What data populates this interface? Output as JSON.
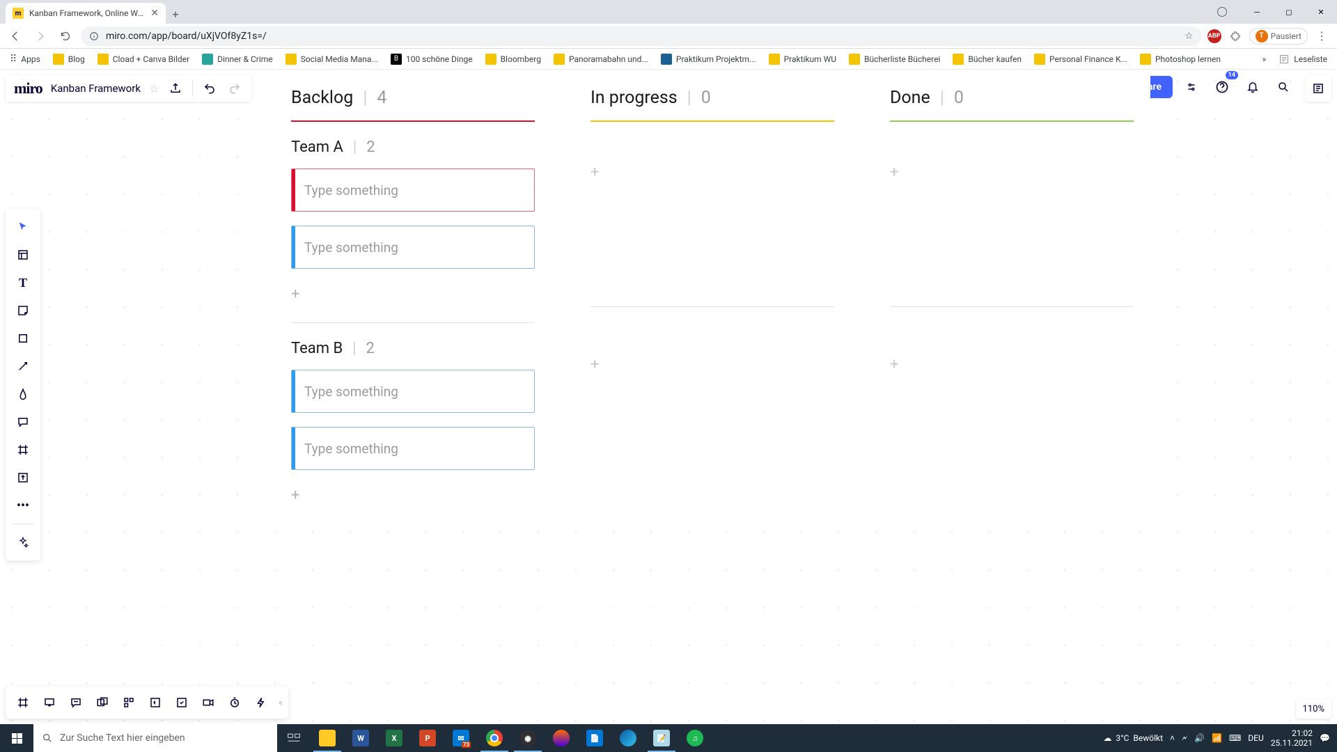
{
  "browser": {
    "tab_title": "Kanban Framework, Online Whit…",
    "url": "miro.com/app/board/uXjVOf8yZ1s=/",
    "paused_label": "Pausiert",
    "bookmarks": [
      {
        "label": "Apps",
        "color": "#5f6368"
      },
      {
        "label": "Blog",
        "color": "#f5c400"
      },
      {
        "label": "Cload + Canva Bilder",
        "color": "#f5c400"
      },
      {
        "label": "Dinner & Crime",
        "color": "#2aa39a"
      },
      {
        "label": "Social Media Mana...",
        "color": "#f5c400"
      },
      {
        "label": "100 schöne Dinge",
        "color": "#000"
      },
      {
        "label": "Bloomberg",
        "color": "#f5c400"
      },
      {
        "label": "Panoramabahn und...",
        "color": "#f5c400"
      },
      {
        "label": "Praktikum Projektm...",
        "color": "#1a6091"
      },
      {
        "label": "Praktikum WU",
        "color": "#f5c400"
      },
      {
        "label": "Bücherliste Bücherei",
        "color": "#f5c400"
      },
      {
        "label": "Bücher kaufen",
        "color": "#f5c400"
      },
      {
        "label": "Personal Finance K...",
        "color": "#f5c400"
      },
      {
        "label": "Photoshop lernen",
        "color": "#f5c400"
      }
    ],
    "reading_list": "Leseliste"
  },
  "miro": {
    "logo": "miro",
    "board_name": "Kanban Framework",
    "share_label": "Share",
    "help_badge": "14",
    "zoom": "110%"
  },
  "kanban": {
    "columns": [
      {
        "title": "Backlog",
        "count": "4",
        "rule": "rule-red"
      },
      {
        "title": "In progress",
        "count": "0",
        "rule": "rule-yellow"
      },
      {
        "title": "Done",
        "count": "0",
        "rule": "rule-green"
      }
    ],
    "teams": [
      {
        "name": "Team A",
        "count": "2",
        "cards": [
          {
            "placeholder": "Type something",
            "style": "card-red"
          },
          {
            "placeholder": "Type something",
            "style": "card-blue"
          }
        ]
      },
      {
        "name": "Team B",
        "count": "2",
        "cards": [
          {
            "placeholder": "Type something",
            "style": "card-blue"
          },
          {
            "placeholder": "Type something",
            "style": "card-blue"
          }
        ]
      }
    ]
  },
  "taskbar": {
    "search_placeholder": "Zur Suche Text hier eingeben",
    "weather_temp": "3°C",
    "weather_text": "Bewölkt",
    "lang": "DEU",
    "time": "21:02",
    "date": "25.11.2021"
  }
}
